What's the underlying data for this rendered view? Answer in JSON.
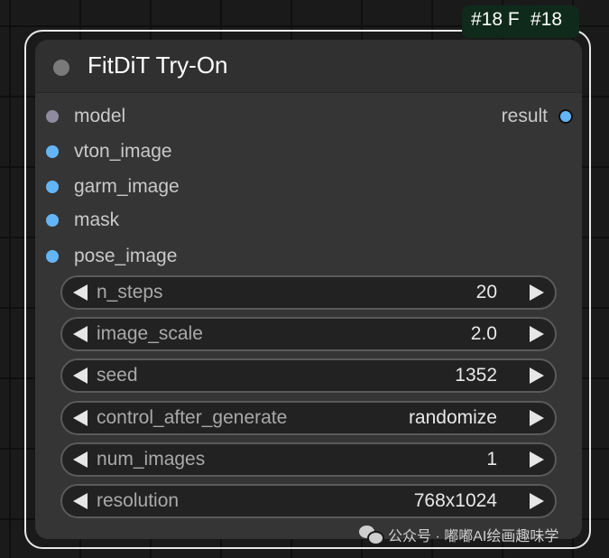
{
  "badges": [
    "#18 F",
    "#18"
  ],
  "node": {
    "title": "FitDiT Try-On",
    "inputs": [
      {
        "label": "model",
        "type": "model"
      },
      {
        "label": "vton_image",
        "type": "image"
      },
      {
        "label": "garm_image",
        "type": "image"
      },
      {
        "label": "mask",
        "type": "image"
      },
      {
        "label": "pose_image",
        "type": "image"
      }
    ],
    "output": {
      "label": "result"
    },
    "widgets": [
      {
        "label": "n_steps",
        "value": "20"
      },
      {
        "label": "image_scale",
        "value": "2.0"
      },
      {
        "label": "seed",
        "value": "1352"
      },
      {
        "label": "control_after_generate",
        "value": "randomize"
      },
      {
        "label": "num_images",
        "value": "1"
      },
      {
        "label": "resolution",
        "value": "768x1024"
      }
    ]
  },
  "watermark": {
    "text": "公众号 · 嘟嘟AI绘画趣味学",
    "icon": "wechat-icon"
  },
  "colors": {
    "image_slot": "#64b5f6",
    "model_slot": "#8f8aa0",
    "node_bg": "#353535"
  }
}
